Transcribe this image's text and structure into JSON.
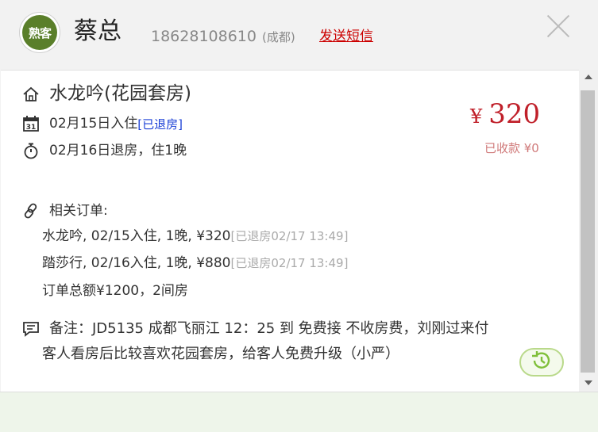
{
  "header": {
    "avatar_badge": "熟客",
    "name": "蔡总",
    "phone": "18628108610",
    "city": "(成都)",
    "send_sms_label": "发送短信"
  },
  "booking": {
    "room": "水龙吟(花园套房)",
    "checkin": "02月15日入住",
    "checkin_status": "[已退房]",
    "checkout": "02月16日退房，住1晚",
    "price_symbol": "¥",
    "price": "320",
    "paid": "已收款 ¥0"
  },
  "related": {
    "title": "相关订单:",
    "orders": [
      {
        "text": "水龙吟, 02/15入住, 1晚, ¥320",
        "status": "[已退房02/17 13:49]"
      },
      {
        "text": "踏莎行, 02/16入住, 1晚, ¥880",
        "status": "[已退房02/17 13:49]"
      }
    ],
    "total": "订单总额¥1200，2间房"
  },
  "note": {
    "line1": "备注：JD5135 成都飞丽江 12：25 到 免费接 不收房费，刘刚过来付",
    "line2": "客人看房后比较喜欢花园套房，给客人免费升级（小严）"
  },
  "icons": [
    "home-icon",
    "calendar-icon",
    "stopwatch-icon",
    "link-icon",
    "comment-icon",
    "history-icon",
    "close-icon"
  ],
  "colors": {
    "price": "#c0202a",
    "sms": "#cc0000",
    "status_link": "#1a3fd6",
    "avatar": "#5a7f2a"
  }
}
